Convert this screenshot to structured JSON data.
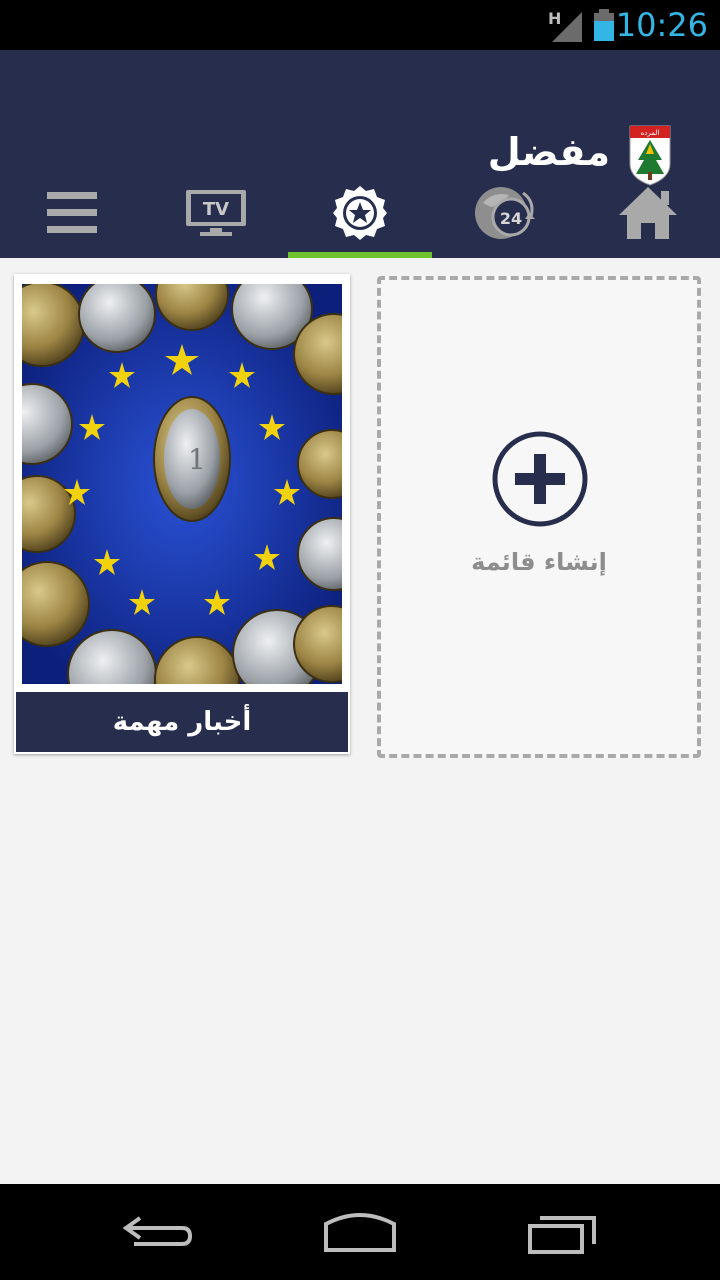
{
  "status_bar": {
    "time": "10:26",
    "network_type": "H",
    "icons": [
      "signal-icon",
      "battery-icon"
    ]
  },
  "app_bar": {
    "title": "مفضل",
    "logo_text": "المرده",
    "logo_icon": "crest-logo"
  },
  "tabs": [
    {
      "name": "home",
      "icon": "home-icon"
    },
    {
      "name": "24h",
      "icon": "clock-24-icon",
      "label": "24"
    },
    {
      "name": "favorites",
      "icon": "star-badge-icon",
      "selected": true
    },
    {
      "name": "tv",
      "icon": "tv-icon",
      "label": "TV"
    },
    {
      "name": "menu",
      "icon": "menu-icon"
    }
  ],
  "colors": {
    "primary": "#272e4d",
    "accent_indicator": "#6fc22e",
    "status_time": "#33b5e5",
    "background": "#f3f3f3"
  },
  "lists": [
    {
      "title": "أخبار مهمة",
      "image": "euro-coins-eu-flag"
    }
  ],
  "create_list": {
    "label": "إنشاء قائمة",
    "icon": "plus-circle-icon"
  },
  "nav_bar": {
    "icons": [
      "back-icon",
      "home-outline-icon",
      "recents-icon"
    ]
  }
}
